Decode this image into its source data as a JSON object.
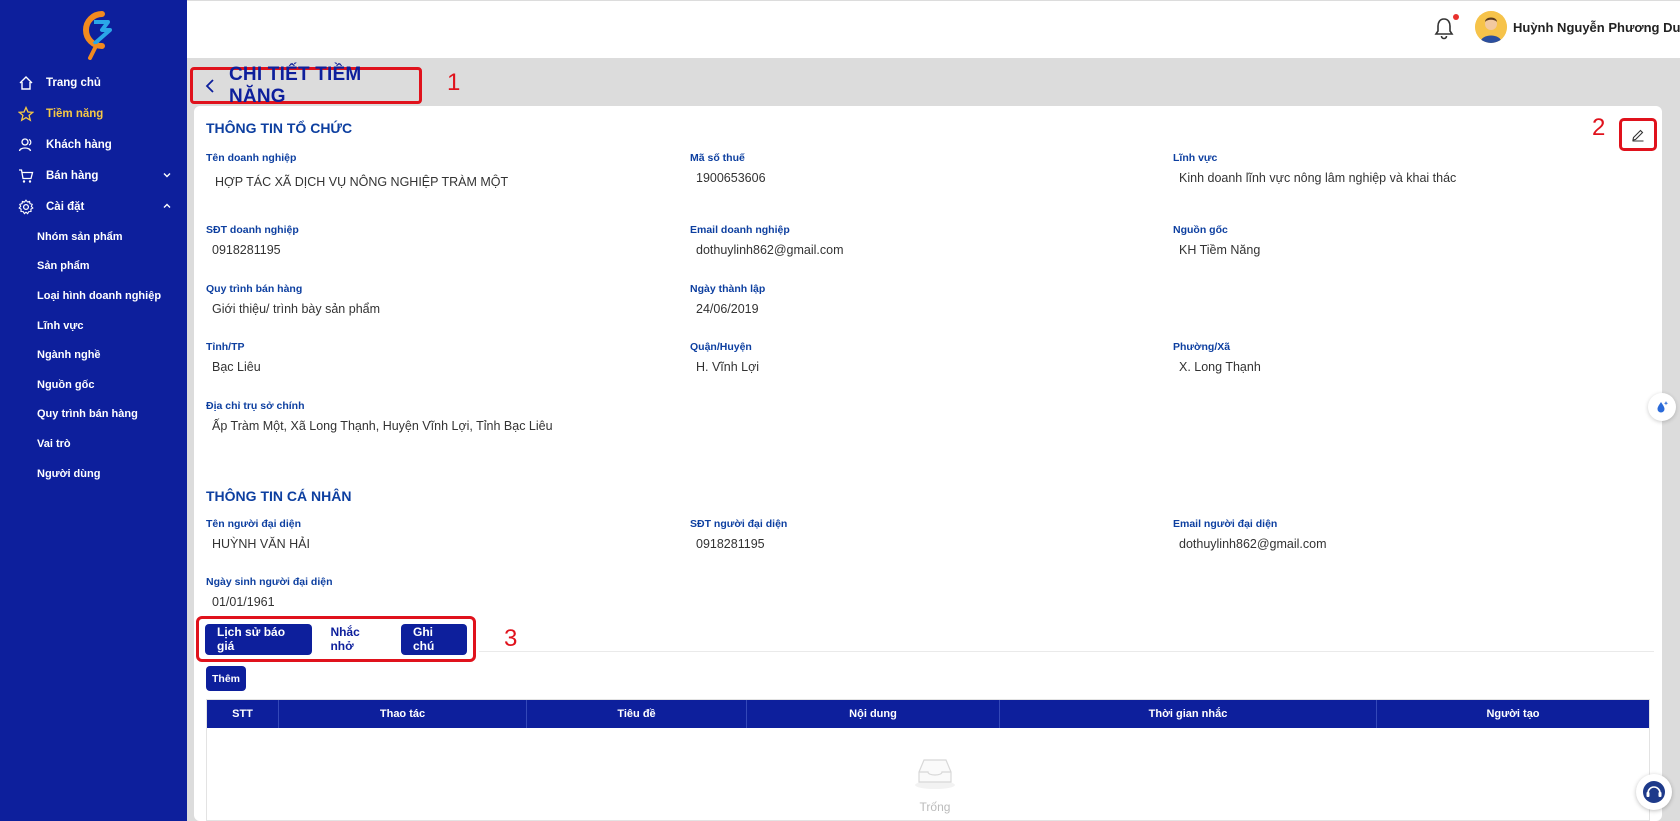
{
  "sidebar": {
    "logo_icon": "c9-logo-icon",
    "items": [
      {
        "label": "Trang chủ",
        "icon": "home-icon"
      },
      {
        "label": "Tiềm năng",
        "icon": "star-icon",
        "active": true
      },
      {
        "label": "Khách hàng",
        "icon": "users-icon"
      },
      {
        "label": "Bán hàng",
        "icon": "cart-icon",
        "caret": "chevron-down-icon"
      },
      {
        "label": "Cài đặt",
        "icon": "gear-icon",
        "caret": "chevron-up-icon"
      }
    ],
    "sub_items": [
      "Nhóm sản phẩm",
      "Sản phẩm",
      "Loại hình doanh nghiệp",
      "Lĩnh vực",
      "Ngành nghề",
      "Nguồn gốc",
      "Quy trình bán hàng",
      "Vai trò",
      "Người dùng"
    ],
    "active_color": "#f6c945",
    "background": "#0d1f9c"
  },
  "header": {
    "user_name": "Huỳnh Nguyễn Phương Duy",
    "notification_icon": "bell-icon"
  },
  "page": {
    "title": "CHI TIẾT TIỀM NĂNG",
    "back_icon": "chevron-left-icon"
  },
  "annotations": [
    "1",
    "2",
    "3"
  ],
  "org_section": {
    "title": "THÔNG TIN TỔ CHỨC",
    "edit_icon": "pencil-icon",
    "fields": [
      {
        "label": "Tên doanh nghiệp",
        "value": "HỢP TÁC XÃ DỊCH VỤ NÔNG NGHIỆP TRÀM MỘT"
      },
      {
        "label": "Mã số thuế",
        "value": "1900653606"
      },
      {
        "label": "Lĩnh vực",
        "value": "Kinh doanh lĩnh vực nông lâm nghiệp và khai thác"
      },
      {
        "label": "SĐT doanh nghiệp",
        "value": "0918281195"
      },
      {
        "label": "Email doanh nghiệp",
        "value": "dothuylinh862@gmail.com"
      },
      {
        "label": "Nguồn gốc",
        "value": "KH Tiềm Năng"
      },
      {
        "label": "Quy trình bán hàng",
        "value": "Giới thiệu/ trình bày sản phẩm"
      },
      {
        "label": "Ngày thành lập",
        "value": "24/06/2019"
      },
      {
        "label": "Tỉnh/TP",
        "value": "Bạc Liêu"
      },
      {
        "label": "Quận/Huyện",
        "value": "H. Vĩnh Lợi"
      },
      {
        "label": "Phường/Xã",
        "value": "X. Long Thạnh"
      },
      {
        "label": "Địa chỉ trụ sở chính",
        "value": "Ấp Tràm Một, Xã Long Thạnh, Huyện Vĩnh Lợi, Tỉnh Bạc Liêu"
      }
    ]
  },
  "personal_section": {
    "title": "THÔNG TIN CÁ NHÂN",
    "fields": [
      {
        "label": "Tên người đại diện",
        "value": "HUỲNH VĂN HẢI"
      },
      {
        "label": "SĐT người đại diện",
        "value": "0918281195"
      },
      {
        "label": "Email người đại diện",
        "value": "dothuylinh862@gmail.com"
      },
      {
        "label": "Ngày sinh người đại diện",
        "value": "01/01/1961"
      }
    ]
  },
  "tabs": [
    {
      "label": "Lịch sử báo giá",
      "style": "filled"
    },
    {
      "label": "Nhắc nhở",
      "style": "plain"
    },
    {
      "label": "Ghi chú",
      "style": "filled"
    }
  ],
  "add_button": "Thêm",
  "table": {
    "columns": [
      "STT",
      "Thao tác",
      "Tiêu đề",
      "Nội dung",
      "Thời gian nhắc",
      "Người tạo"
    ],
    "empty_text": "Trống",
    "empty_icon": "empty-inbox-icon"
  },
  "colors": {
    "primary": "#0d1f9c",
    "label": "#0d3fa0",
    "highlight_box": "#e0121c"
  }
}
